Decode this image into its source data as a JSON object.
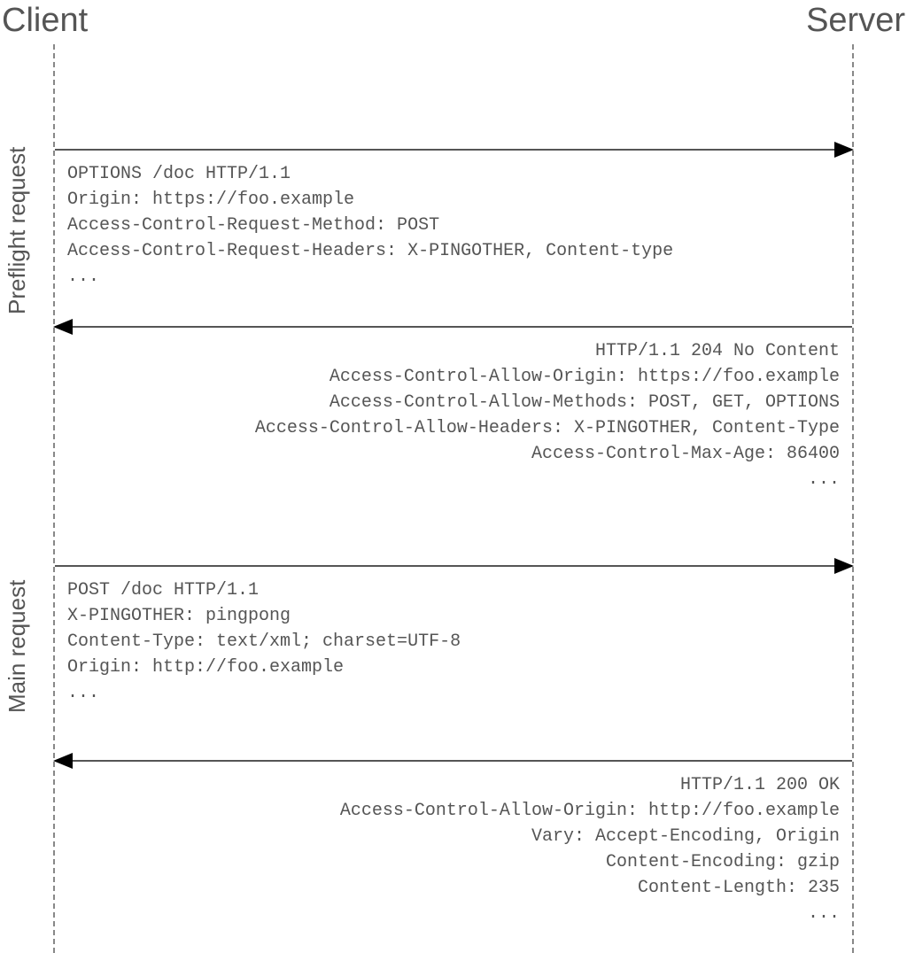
{
  "actors": {
    "client": "Client",
    "server": "Server"
  },
  "sections": {
    "preflight": "Preflight request",
    "main": "Main request"
  },
  "messages": {
    "preflight_request": [
      "OPTIONS /doc HTTP/1.1",
      "Origin: https://foo.example",
      "Access-Control-Request-Method: POST",
      "Access-Control-Request-Headers: X-PINGOTHER, Content-type",
      "..."
    ],
    "preflight_response": [
      "HTTP/1.1 204 No Content",
      "Access-Control-Allow-Origin: https://foo.example",
      "Access-Control-Allow-Methods: POST, GET, OPTIONS",
      "Access-Control-Allow-Headers: X-PINGOTHER, Content-Type",
      "Access-Control-Max-Age: 86400",
      "..."
    ],
    "main_request": [
      "POST /doc HTTP/1.1",
      "X-PINGOTHER: pingpong",
      "Content-Type: text/xml; charset=UTF-8",
      "Origin: http://foo.example",
      "..."
    ],
    "main_response": [
      "HTTP/1.1 200 OK",
      "Access-Control-Allow-Origin: http://foo.example",
      "Vary: Accept-Encoding, Origin",
      "Content-Encoding: gzip",
      "Content-Length: 235",
      "..."
    ]
  }
}
